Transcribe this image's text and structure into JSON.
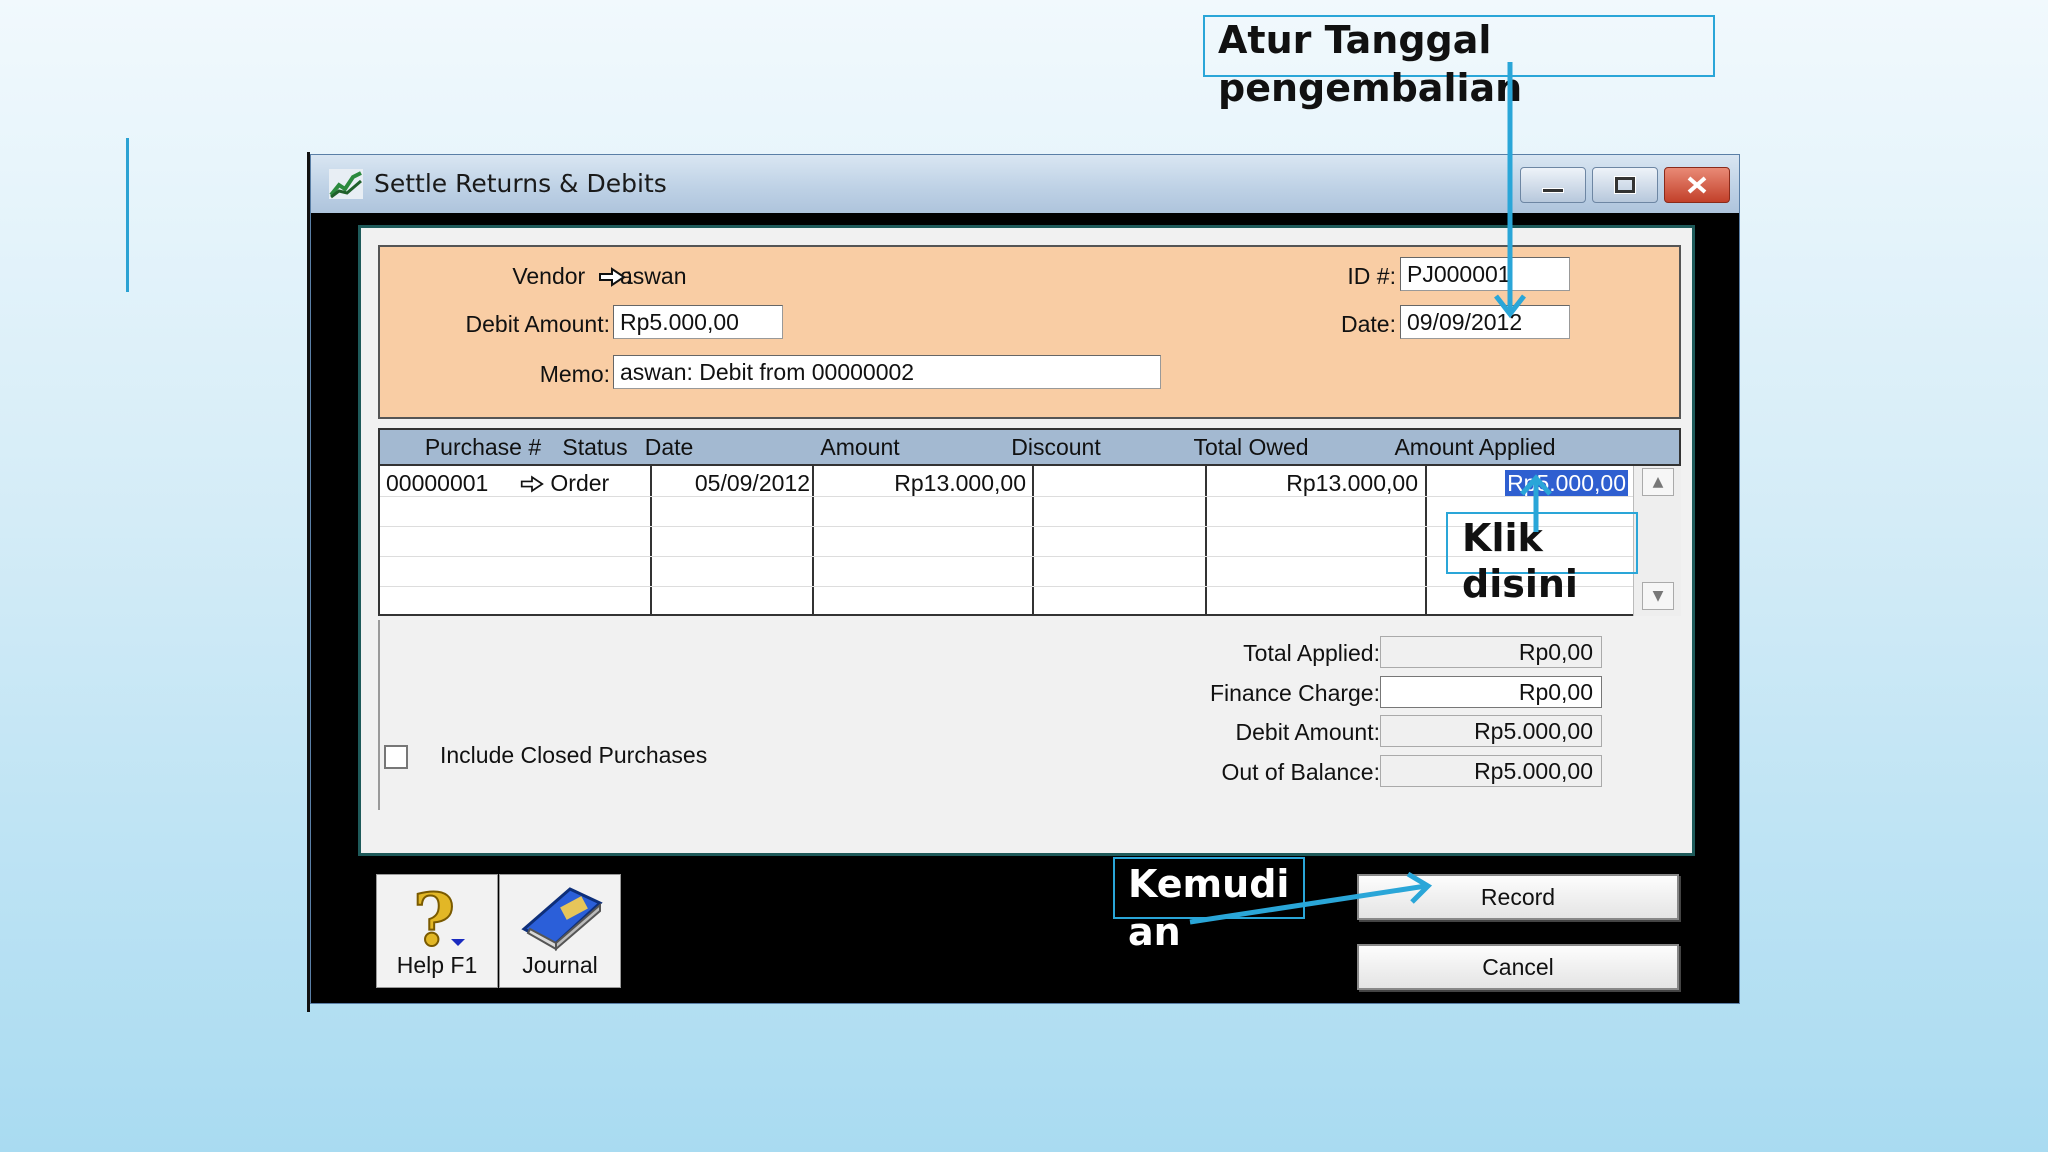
{
  "window": {
    "title": "Settle Returns & Debits",
    "controls": [
      "minimize-icon",
      "maximize-icon",
      "close-icon"
    ]
  },
  "header": {
    "vendor_label": "Vendor",
    "vendor_value": "aswan",
    "debit_amount_label": "Debit Amount:",
    "debit_amount_value": "Rp5.000,00",
    "memo_label": "Memo:",
    "memo_value": "aswan:  Debit from 00000002",
    "id_label": "ID #:",
    "id_value": "PJ000001",
    "date_label": "Date:",
    "date_value": "09/09/2012",
    "link_arrow_icon": "link-arrow-icon"
  },
  "table": {
    "columns": [
      "Purchase #",
      "Status",
      "Date",
      "Amount",
      "Discount",
      "Total Owed",
      "Amount Applied"
    ],
    "rows": [
      {
        "purchase": "00000001",
        "status": "Order",
        "date": "05/09/2012",
        "amount": "Rp13.000,00",
        "discount": "",
        "total_owed": "Rp13.000,00",
        "amount_applied": "Rp5.000,00"
      }
    ]
  },
  "totals": {
    "total_applied_label": "Total Applied:",
    "total_applied_value": "Rp0,00",
    "finance_charge_label": "Finance Charge:",
    "finance_charge_value": "Rp0,00",
    "debit_amount_label": "Debit Amount:",
    "debit_amount_value": "Rp5.000,00",
    "out_of_balance_label": "Out of Balance:",
    "out_of_balance_value": "Rp5.000,00"
  },
  "include_closed": {
    "label": "Include Closed Purchases",
    "checked": false
  },
  "buttons": {
    "help_label": "Help F1",
    "journal_label": "Journal",
    "record_label": "Record",
    "cancel_label": "Cancel"
  },
  "annotations": {
    "date_callout_line1": "Atur Tanggal",
    "date_callout_line2": "pengembalian",
    "click_callout_line1": "Klik",
    "click_callout_line2": "disini",
    "then_callout_line1": "Kemudi",
    "then_callout_line2": "an"
  },
  "colors": {
    "header_panel": "#f9cda4",
    "grid_header": "#a3b9d1",
    "selection": "#2f5fd0",
    "annotation_blue": "#2aa6d8",
    "close_button": "#c2402a"
  }
}
